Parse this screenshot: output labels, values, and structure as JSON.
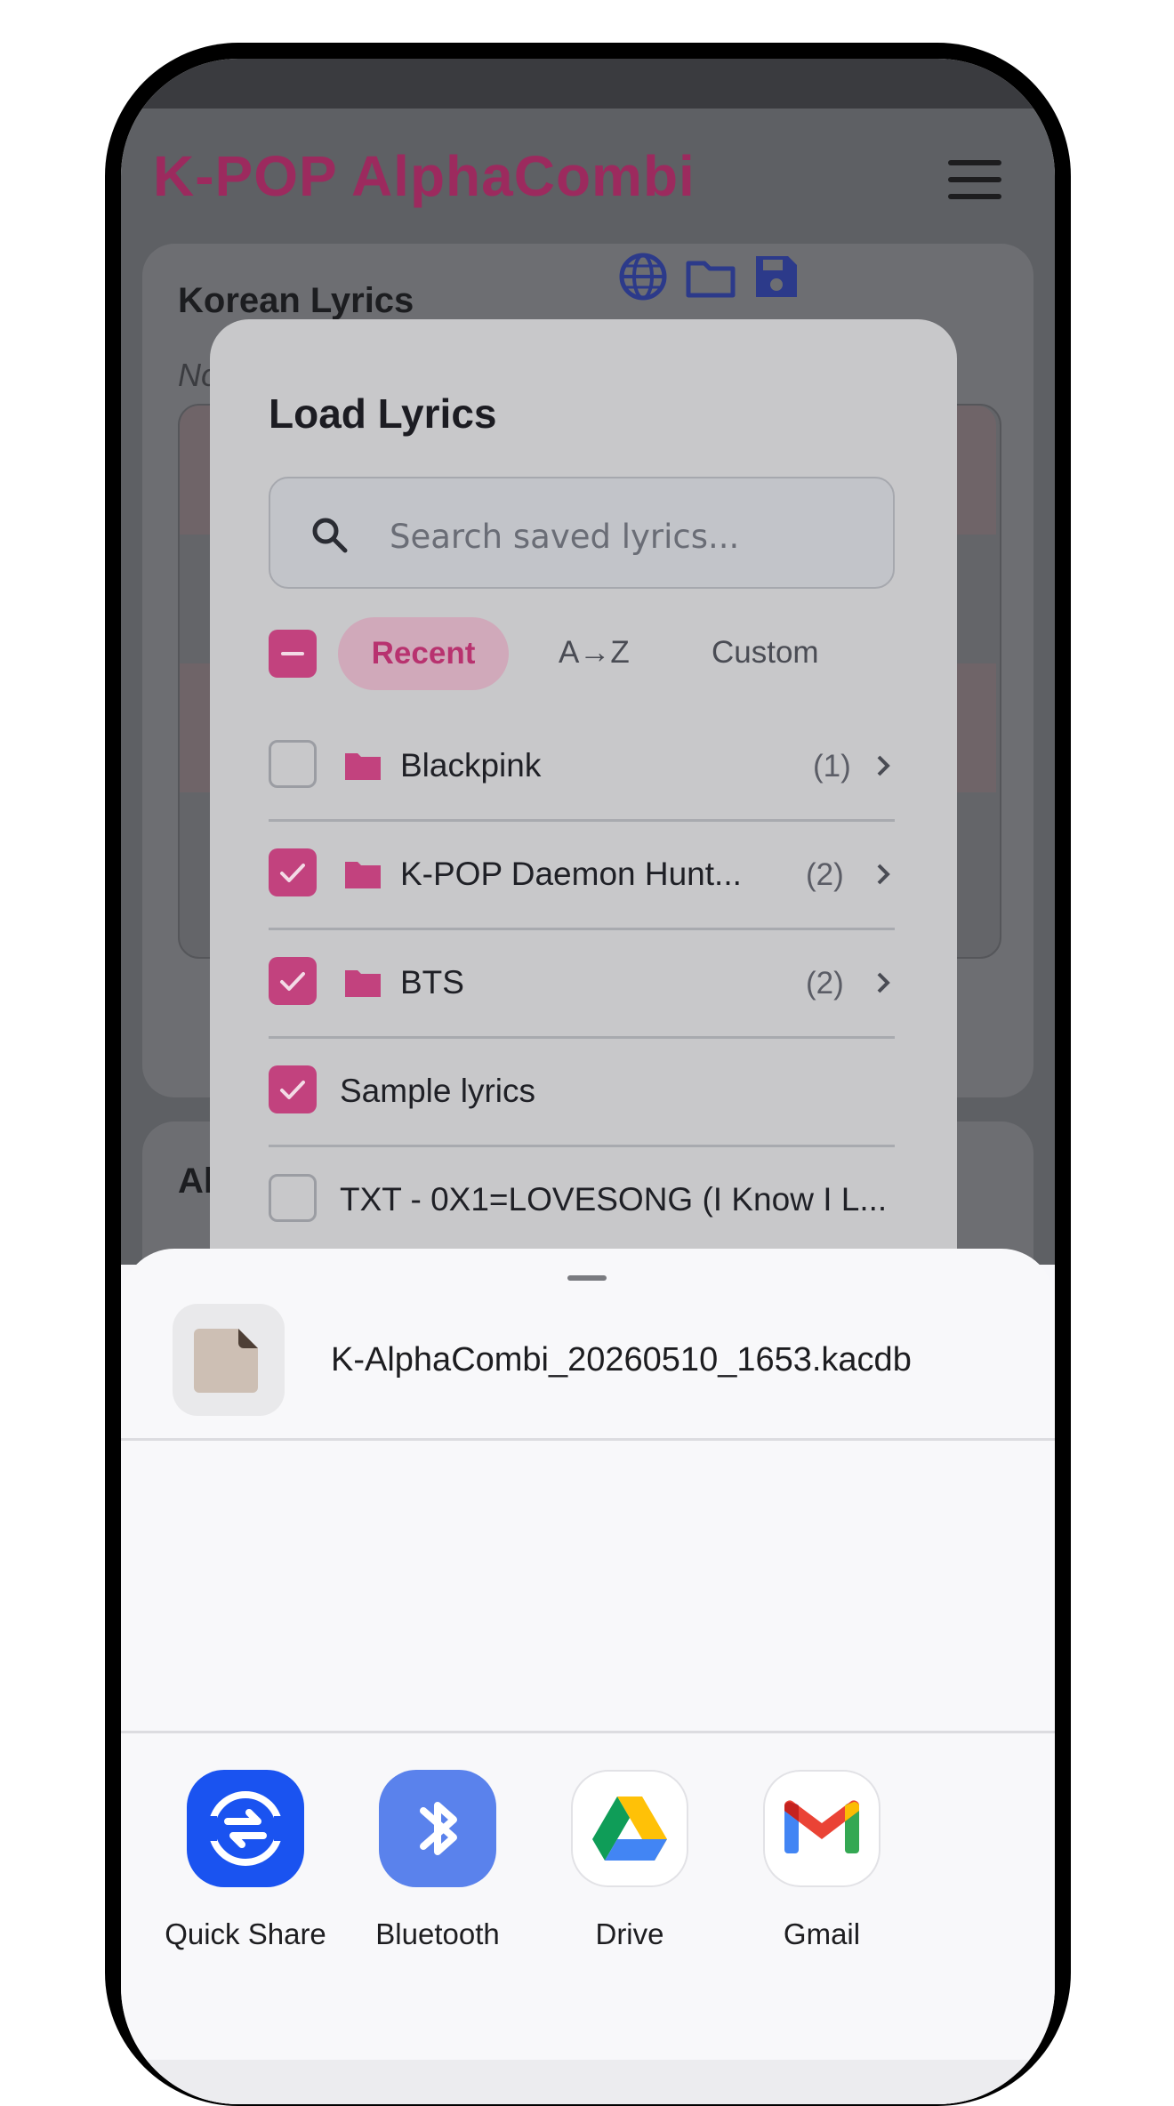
{
  "app": {
    "title": "K-POP AlphaCombi",
    "menu_icon": "hamburger-menu-icon"
  },
  "background": {
    "card1_title": "Korean Lyrics",
    "card1_subtitle": "No",
    "card2_title": "Al",
    "header_icons": [
      "globe-icon",
      "folder-icon",
      "save-icon"
    ]
  },
  "dialog": {
    "title": "Load Lyrics",
    "search": {
      "placeholder": "Search saved lyrics...",
      "value": ""
    },
    "sort": {
      "active": "Recent",
      "options": [
        "Recent",
        "A→Z",
        "Custom"
      ]
    },
    "select_all_state": "indeterminate",
    "items": [
      {
        "type": "folder",
        "label": "Blackpink",
        "count": "(1)",
        "checked": false
      },
      {
        "type": "folder",
        "label": "K-POP Daemon Hunt...",
        "count": "(2)",
        "checked": true
      },
      {
        "type": "folder",
        "label": "BTS",
        "count": "(2)",
        "checked": true
      },
      {
        "type": "file",
        "label": "Sample lyrics",
        "checked": true
      },
      {
        "type": "file",
        "label": "TXT - 0X1=LOVESONG (I Know I L...",
        "checked": false
      }
    ]
  },
  "share_sheet": {
    "file_name": "K-AlphaCombi_20260510_1653.kacdb",
    "targets": [
      {
        "label": "Quick Share",
        "icon": "quick-share-icon",
        "color": "#1a53f0"
      },
      {
        "label": "Bluetooth",
        "icon": "bluetooth-icon",
        "color": "#5a82ec"
      },
      {
        "label": "Drive",
        "icon": "google-drive-icon",
        "color": "#ffffff"
      },
      {
        "label": "Gmail",
        "icon": "gmail-icon",
        "color": "#ffffff"
      }
    ]
  },
  "colors": {
    "accent": "#c2427e",
    "title_pink": "#9c2a5e",
    "overlay_dim": "#5e6064"
  }
}
